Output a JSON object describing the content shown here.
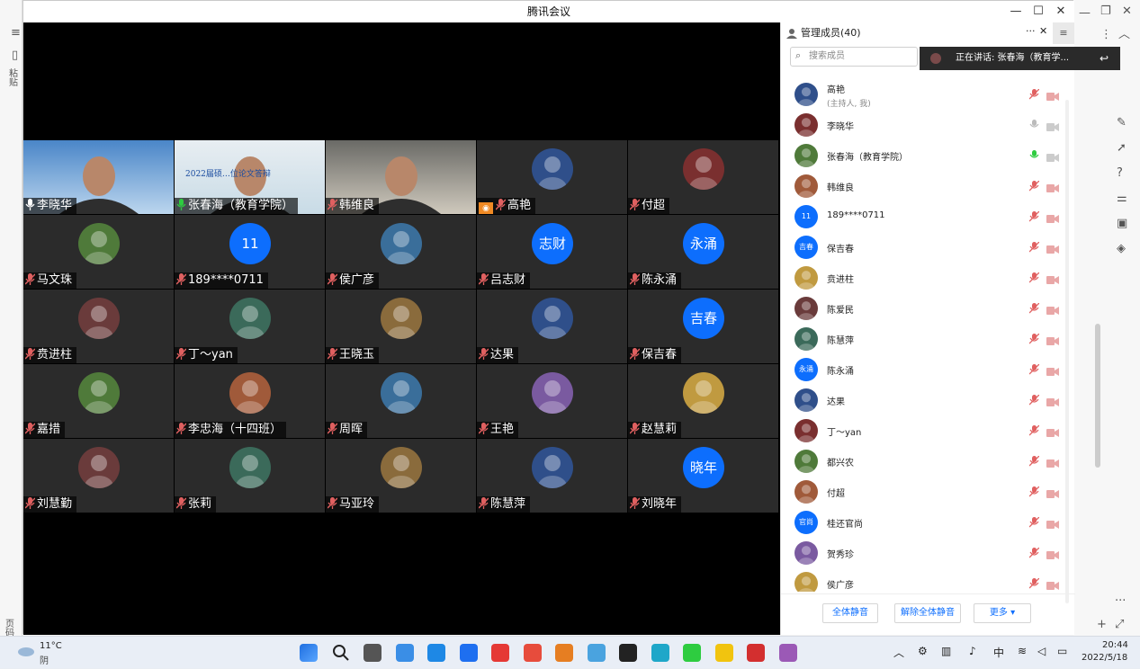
{
  "window": {
    "title": "腾讯会议"
  },
  "background_app": {
    "left_labels": [
      "粘贴"
    ],
    "status_left": "页码"
  },
  "grid": [
    {
      "name": "李晓华",
      "kind": "video",
      "mic": "on"
    },
    {
      "name": "张春海（教育学院）",
      "kind": "video",
      "mic": "active",
      "banner": "2022届硕…位论文答辩"
    },
    {
      "name": "韩维良",
      "kind": "video",
      "mic": "muted"
    },
    {
      "name": "高艳",
      "kind": "avatar",
      "mic": "muted",
      "host": true
    },
    {
      "name": "付超",
      "kind": "avatar",
      "mic": "muted"
    },
    {
      "name": "马文珠",
      "kind": "avatar",
      "mic": "muted"
    },
    {
      "name": "189****0711",
      "kind": "text",
      "avatar_text": "11",
      "mic": "muted"
    },
    {
      "name": "侯广彦",
      "kind": "avatar",
      "mic": "muted"
    },
    {
      "name": "吕志财",
      "kind": "text",
      "avatar_text": "志财",
      "mic": "muted"
    },
    {
      "name": "陈永涌",
      "kind": "text",
      "avatar_text": "永涌",
      "mic": "muted"
    },
    {
      "name": "贲进柱",
      "kind": "avatar",
      "mic": "muted"
    },
    {
      "name": "丁～yan",
      "kind": "avatar",
      "mic": "muted"
    },
    {
      "name": "王晓玉",
      "kind": "avatar",
      "mic": "muted"
    },
    {
      "name": "达果",
      "kind": "avatar",
      "mic": "muted"
    },
    {
      "name": "保吉春",
      "kind": "text",
      "avatar_text": "吉春",
      "mic": "muted"
    },
    {
      "name": "嘉措",
      "kind": "avatar",
      "mic": "muted"
    },
    {
      "name": "李忠海（十四班）",
      "kind": "avatar",
      "mic": "muted"
    },
    {
      "name": "周晖",
      "kind": "avatar",
      "mic": "muted"
    },
    {
      "name": "王艳",
      "kind": "avatar",
      "mic": "muted"
    },
    {
      "name": "赵慧莉",
      "kind": "avatar",
      "mic": "muted"
    },
    {
      "name": "刘慧勤",
      "kind": "avatar",
      "mic": "muted"
    },
    {
      "name": "张莉",
      "kind": "avatar",
      "mic": "muted"
    },
    {
      "name": "马亚玲",
      "kind": "avatar",
      "mic": "muted"
    },
    {
      "name": "陈慧萍",
      "kind": "avatar",
      "mic": "muted"
    },
    {
      "name": "刘晓年",
      "kind": "text",
      "avatar_text": "晓年",
      "mic": "muted"
    }
  ],
  "panel": {
    "title": "管理成员(40)",
    "search_placeholder": "搜索成员",
    "speaking": "正在讲话: 张春海（教育学...",
    "members": [
      {
        "name": "高艳",
        "sub": "(主持人, 我)",
        "mic": "muted",
        "avatar_text": ""
      },
      {
        "name": "李晓华",
        "mic": "on",
        "avatar_text": ""
      },
      {
        "name": "张春海（教育学院）",
        "mic": "active",
        "avatar_text": ""
      },
      {
        "name": "韩维良",
        "mic": "muted",
        "avatar_text": ""
      },
      {
        "name": "189****0711",
        "mic": "muted",
        "avatar_text": "11"
      },
      {
        "name": "保吉春",
        "mic": "muted",
        "avatar_text": "吉春"
      },
      {
        "name": "贲进柱",
        "mic": "muted",
        "avatar_text": ""
      },
      {
        "name": "陈爱民",
        "mic": "muted",
        "avatar_text": ""
      },
      {
        "name": "陈慧萍",
        "mic": "muted",
        "avatar_text": ""
      },
      {
        "name": "陈永涌",
        "mic": "muted",
        "avatar_text": "永涌"
      },
      {
        "name": "达果",
        "mic": "muted",
        "avatar_text": ""
      },
      {
        "name": "丁～yan",
        "mic": "muted",
        "avatar_text": ""
      },
      {
        "name": "都兴农",
        "mic": "muted",
        "avatar_text": ""
      },
      {
        "name": "付超",
        "mic": "muted",
        "avatar_text": ""
      },
      {
        "name": "桂还官尚",
        "mic": "muted",
        "avatar_text": "官尚"
      },
      {
        "name": "贺秀珍",
        "mic": "muted",
        "avatar_text": ""
      },
      {
        "name": "侯广彦",
        "mic": "muted",
        "avatar_text": ""
      }
    ],
    "mute_all": "全体静音",
    "unmute_all": "解除全体静音",
    "more": "更多"
  },
  "taskbar": {
    "weather_temp": "11°C",
    "weather_desc": "阴",
    "ime": "中",
    "time": "20:44",
    "date": "2022/5/18"
  },
  "colors": {
    "accent": "#0d6efd",
    "muted": "#e06060",
    "active_mic": "#2ecc40"
  }
}
